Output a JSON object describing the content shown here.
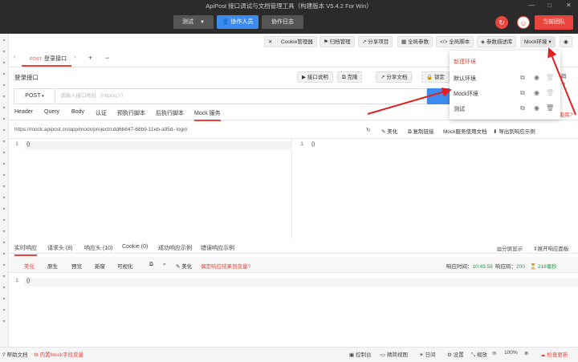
{
  "window": {
    "title": "ApiPost 接口调试与文档管理工具（构建版本 V5.4.2 For Win）",
    "controls": {
      "min": "—",
      "max": "□",
      "close": "✕"
    }
  },
  "header": {
    "env_label": "测试",
    "collab_label": "协作人员",
    "log_label": "协作日志",
    "team_label": "当前团队"
  },
  "toolbar": [
    "Cookie管理器",
    "归档管理",
    "分享项目",
    "全局参数",
    "全局脚本",
    "参数描述库",
    "Mock环境"
  ],
  "tab": {
    "method": "POST",
    "name": "登录接口"
  },
  "api": {
    "title": "登录接口",
    "buttons": [
      "接口说明",
      "克隆",
      "分享文档",
      "锁定",
      "码"
    ],
    "method": "POST",
    "url_placeholder": "请输入接口地址（http(s)://）"
  },
  "subtabs": [
    "Header",
    "Query",
    "Body",
    "认证",
    "预执行脚本",
    "后执行脚本",
    "Mock 服务"
  ],
  "mock": {
    "url": "https://mock.apipost.cn/app/mock/project/cdd6b847-68b9-11eb-a95d-  login",
    "actions": [
      "美化",
      "复制链接",
      "Mock服务使用文档",
      "导出到响应示例"
    ]
  },
  "editor": {
    "left_line": "1",
    "left_text": "{}",
    "right_line": "1",
    "right_text": "{}"
  },
  "response": {
    "tabs": [
      "实时响应",
      "请求头 (8)",
      "响应头 (10)",
      "Cookie (0)",
      "成功响应示例",
      "错误响应示例"
    ],
    "right_actions": [
      "分屏显示",
      "展开响应面板"
    ],
    "modes": [
      "美化",
      "原生",
      "预览",
      "新窗",
      "可视化"
    ],
    "beautify": "美化",
    "hint": "偶定响应结果到变量?",
    "time_label": "响应时间：",
    "time_value": "10:49:58",
    "code_label": "响应码：",
    "code_value": "200",
    "duration": "218毫秒",
    "body_line": "1",
    "body_text": "{}"
  },
  "statusbar": {
    "left": [
      "帮助文档",
      "内置Mock字段变量"
    ],
    "right": [
      "控制台",
      "精简视图",
      "日间",
      "设置",
      "缩放",
      "100%",
      "检查更新"
    ]
  },
  "dropdown": {
    "new_env": "新建环境",
    "items": [
      "默认环境",
      "Mock环境",
      "测试"
    ]
  },
  "sidebar_hint": "能库?",
  "colors": {
    "accent": "#e8453c",
    "primary": "#3c8cf0",
    "titlebar": "#2b2b2b"
  }
}
